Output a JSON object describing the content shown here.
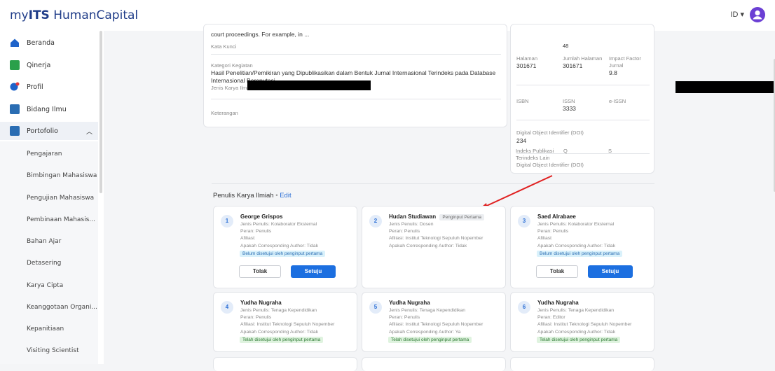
{
  "app": {
    "logo_prefix": "my",
    "logo_brand": "ITS",
    "logo_suffix": "HumanCapital",
    "lang": "ID ▾"
  },
  "sidebar": {
    "items": [
      {
        "label": "Beranda",
        "color": "#1f63c9"
      },
      {
        "label": "Qinerja",
        "color": "#2aa04a"
      },
      {
        "label": "Profil",
        "color": "#1f63c9"
      },
      {
        "label": "Bidang Ilmu",
        "color": "#2a6db3"
      },
      {
        "label": "Portofolio",
        "color": "#2a6db3"
      }
    ],
    "sub_items": [
      "Pengajaran",
      "Bimbingan Mahasiswa",
      "Pengujian Mahasiswa",
      "Pembinaan Mahasis...",
      "Bahan Ajar",
      "Detasering",
      "Karya Cipta",
      "Keanggotaan Organi...",
      "Kepanitiaan",
      "Visiting Scientist"
    ]
  },
  "detail": {
    "abstract_tail": "court proceedings. For example, in ...",
    "kata_kunci_label": "Kata Kunci",
    "kategori_label": "Kategori Kegiatan",
    "kategori_value_1": "Hasil Penelitian/Pemikiran yang Dipublikasikan dalam Bentuk Jurnal Internasional Terindeks pada Database",
    "kategori_value_2": "Internasional Bereputasi",
    "jenis_label": "Jenis Karya Ilmiah",
    "keterangan_label": "Keterangan"
  },
  "meta": {
    "top_value": "48",
    "halaman_label": "Halaman",
    "halaman_value": "301671",
    "jumlah_label": "Jumlah Halaman",
    "jumlah_value": "301671",
    "impact_label_1": "Impact Factor",
    "impact_label_2": "Jurnal",
    "impact_value": "9.8",
    "isbn_label": "ISBN",
    "issn_label": "ISSN",
    "issn_value": "3333",
    "eissn_label": "e-ISSN",
    "doi_label": "Digital Object Identifier (DOI)",
    "doi_value": "234",
    "doi_label_2": "Digital Object Identifier (DOI)",
    "indeks_label_1": "Indeks Publikasi",
    "indeks_label_2": "Terindeks Lain",
    "q_label": "Q",
    "s_label": "S"
  },
  "authors_section": {
    "title": "Penulis Karya Ilmiah",
    "sep": "•",
    "edit": "Edit"
  },
  "authors": [
    {
      "num": "1",
      "name": "George Grispos",
      "lines": [
        "Jenis Penulis: Kolaborator Eksternal",
        "Peran: Penulis",
        "Afiliasi:",
        "Apakah Corresponding Author: Tidak"
      ],
      "badge": "Belum disetujui oleh penginput pertama",
      "badge_type": "blue",
      "reject": "Tolak",
      "approve": "Setuju"
    },
    {
      "num": "2",
      "name": "Hudan Studiawan",
      "tag": "Penginput Pertama",
      "lines": [
        "Jenis Penulis: Dosen",
        "Peran: Penulis",
        "Afiliasi: Institut Teknologi Sepuluh Nopember",
        "Apakah Corresponding Author: Tidak"
      ]
    },
    {
      "num": "3",
      "name": "Saed Alrabaee",
      "lines": [
        "Jenis Penulis: Kolaborator Eksternal",
        "Peran: Penulis",
        "Afiliasi:",
        "Apakah Corresponding Author: Tidak"
      ],
      "badge": "Belum disetujui oleh penginput pertama",
      "badge_type": "blue",
      "reject": "Tolak",
      "approve": "Setuju"
    },
    {
      "num": "4",
      "name": "Yudha Nugraha",
      "lines": [
        "Jenis Penulis: Tenaga Kependidikan",
        "Peran: Penulis",
        "Afiliasi: Institut Teknologi Sepuluh Nopember",
        "Apakah Corresponding Author: Tidak"
      ],
      "badge": "Telah disetujui oleh penginput pertama",
      "badge_type": "green"
    },
    {
      "num": "5",
      "name": "Yudha Nugraha",
      "lines": [
        "Jenis Penulis: Tenaga Kependidikan",
        "Peran: Penulis",
        "Afiliasi: Institut Teknologi Sepuluh Nopember",
        "Apakah Corresponding Author: Ya"
      ],
      "badge": "Telah disetujui oleh penginput pertama",
      "badge_type": "green"
    },
    {
      "num": "6",
      "name": "Yudha Nugraha",
      "lines": [
        "Jenis Penulis: Tenaga Kependidikan",
        "Peran: Editor",
        "Afiliasi: Institut Teknologi Sepuluh Nopember",
        "Apakah Corresponding Author: Tidak"
      ],
      "badge": "Telah disetujui oleh penginput pertama",
      "badge_type": "green"
    }
  ]
}
